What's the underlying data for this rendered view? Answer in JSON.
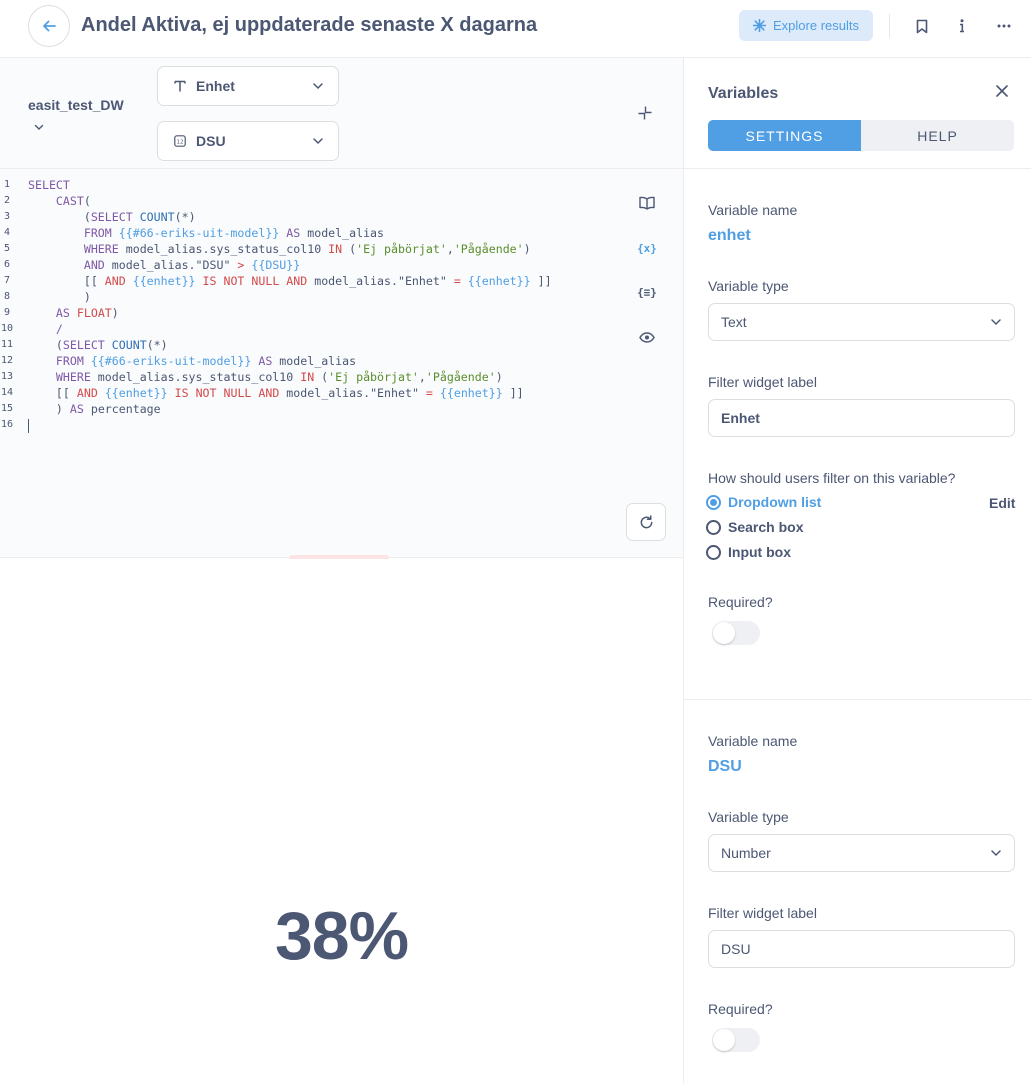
{
  "header": {
    "title": "Andel Aktiva, ej uppdaterade senaste X dagarna",
    "explore_label": "Explore results",
    "accent_color": "#509ee3",
    "icons": [
      "back-arrow-icon",
      "sparkle-icon",
      "bookmark-icon",
      "info-icon",
      "more-icon"
    ]
  },
  "editor": {
    "database": "easit_test_DW",
    "params": [
      {
        "type_icon": "text-type-icon",
        "label": "Enhet"
      },
      {
        "type_icon": "number-type-icon",
        "label": "DSU"
      }
    ],
    "side_icons": [
      "book-icon",
      "variable-icon",
      "snippet-icon",
      "preview-icon"
    ],
    "lines": [
      {
        "n": "1",
        "tokens": [
          {
            "t": "SELECT",
            "c": "kw"
          }
        ]
      },
      {
        "n": "2",
        "tokens": [
          {
            "t": "    "
          },
          {
            "t": "CAST",
            "c": "kw"
          },
          {
            "t": "("
          }
        ]
      },
      {
        "n": "3",
        "tokens": [
          {
            "t": "        ("
          },
          {
            "t": "SELECT",
            "c": "kw"
          },
          {
            "t": " "
          },
          {
            "t": "COUNT",
            "c": "fn"
          },
          {
            "t": "(*)"
          }
        ]
      },
      {
        "n": "4",
        "tokens": [
          {
            "t": "        "
          },
          {
            "t": "FROM",
            "c": "kw"
          },
          {
            "t": " "
          },
          {
            "t": "{{#66-eriks-uit-model}}",
            "c": "tag"
          },
          {
            "t": " "
          },
          {
            "t": "AS",
            "c": "kw"
          },
          {
            "t": " model_alias"
          }
        ]
      },
      {
        "n": "5",
        "tokens": [
          {
            "t": "        "
          },
          {
            "t": "WHERE",
            "c": "kw"
          },
          {
            "t": " model_alias.sys_status_col10 "
          },
          {
            "t": "IN",
            "c": "op"
          },
          {
            "t": " ("
          },
          {
            "t": "'Ej påbörjat'",
            "c": "str"
          },
          {
            "t": ","
          },
          {
            "t": "'Pågående'",
            "c": "str"
          },
          {
            "t": ")"
          }
        ]
      },
      {
        "n": "6",
        "tokens": [
          {
            "t": "        "
          },
          {
            "t": "AND",
            "c": "kw"
          },
          {
            "t": " model_alias.\"DSU\" "
          },
          {
            "t": ">",
            "c": "op"
          },
          {
            "t": " "
          },
          {
            "t": "{{DSU}}",
            "c": "tag"
          }
        ]
      },
      {
        "n": "7",
        "tokens": [
          {
            "t": "        [[ "
          },
          {
            "t": "AND",
            "c": "op"
          },
          {
            "t": " "
          },
          {
            "t": "{{enhet}}",
            "c": "tag"
          },
          {
            "t": " "
          },
          {
            "t": "IS NOT NULL AND",
            "c": "op"
          },
          {
            "t": " model_alias.\"Enhet\" "
          },
          {
            "t": "=",
            "c": "op"
          },
          {
            "t": " "
          },
          {
            "t": "{{enhet}}",
            "c": "tag"
          },
          {
            "t": " ]]"
          }
        ]
      },
      {
        "n": "8",
        "tokens": [
          {
            "t": "        )"
          }
        ]
      },
      {
        "n": "9",
        "tokens": [
          {
            "t": "    "
          },
          {
            "t": "AS",
            "c": "kw"
          },
          {
            "t": " "
          },
          {
            "t": "FLOAT",
            "c": "op"
          },
          {
            "t": ")"
          }
        ]
      },
      {
        "n": "10",
        "tokens": [
          {
            "t": "    "
          },
          {
            "t": "/",
            "c": "kw"
          }
        ]
      },
      {
        "n": "11",
        "tokens": [
          {
            "t": "    ("
          },
          {
            "t": "SELECT",
            "c": "kw"
          },
          {
            "t": " "
          },
          {
            "t": "COUNT",
            "c": "fn"
          },
          {
            "t": "(*)"
          }
        ]
      },
      {
        "n": "12",
        "tokens": [
          {
            "t": "    "
          },
          {
            "t": "FROM",
            "c": "kw"
          },
          {
            "t": " "
          },
          {
            "t": "{{#66-eriks-uit-model}}",
            "c": "tag"
          },
          {
            "t": " "
          },
          {
            "t": "AS",
            "c": "kw"
          },
          {
            "t": " model_alias"
          }
        ]
      },
      {
        "n": "13",
        "tokens": [
          {
            "t": "    "
          },
          {
            "t": "WHERE",
            "c": "kw"
          },
          {
            "t": " model_alias.sys_status_col10 "
          },
          {
            "t": "IN",
            "c": "op"
          },
          {
            "t": " ("
          },
          {
            "t": "'Ej påbörjat'",
            "c": "str"
          },
          {
            "t": ","
          },
          {
            "t": "'Pågående'",
            "c": "str"
          },
          {
            "t": ")"
          }
        ]
      },
      {
        "n": "14",
        "tokens": [
          {
            "t": "    [[ "
          },
          {
            "t": "AND",
            "c": "op"
          },
          {
            "t": " "
          },
          {
            "t": "{{enhet}}",
            "c": "tag"
          },
          {
            "t": " "
          },
          {
            "t": "IS NOT NULL AND",
            "c": "op"
          },
          {
            "t": " model_alias.\"Enhet\" "
          },
          {
            "t": "=",
            "c": "op"
          },
          {
            "t": " "
          },
          {
            "t": "{{enhet}}",
            "c": "tag"
          },
          {
            "t": " ]]"
          }
        ]
      },
      {
        "n": "15",
        "tokens": [
          {
            "t": "    ) "
          },
          {
            "t": "AS",
            "c": "kw"
          },
          {
            "t": " percentage"
          }
        ]
      },
      {
        "n": "16",
        "tokens": []
      }
    ]
  },
  "result": {
    "value": "38%"
  },
  "panel": {
    "title": "Variables",
    "tabs": [
      {
        "label": "SETTINGS",
        "active": true
      },
      {
        "label": "HELP",
        "active": false
      }
    ],
    "labels": {
      "variable_name": "Variable name",
      "variable_type": "Variable type",
      "filter_widget_label": "Filter widget label",
      "how_filter": "How should users filter on this variable?",
      "required": "Required?",
      "edit": "Edit"
    },
    "variables": [
      {
        "name": "enhet",
        "type": "Text",
        "widget_label": "Enhet",
        "filter_options": [
          {
            "label": "Dropdown list",
            "checked": true
          },
          {
            "label": "Search box",
            "checked": false
          },
          {
            "label": "Input box",
            "checked": false
          }
        ],
        "required": false
      },
      {
        "name": "DSU",
        "type": "Number",
        "widget_label": "DSU",
        "required": false
      }
    ]
  }
}
